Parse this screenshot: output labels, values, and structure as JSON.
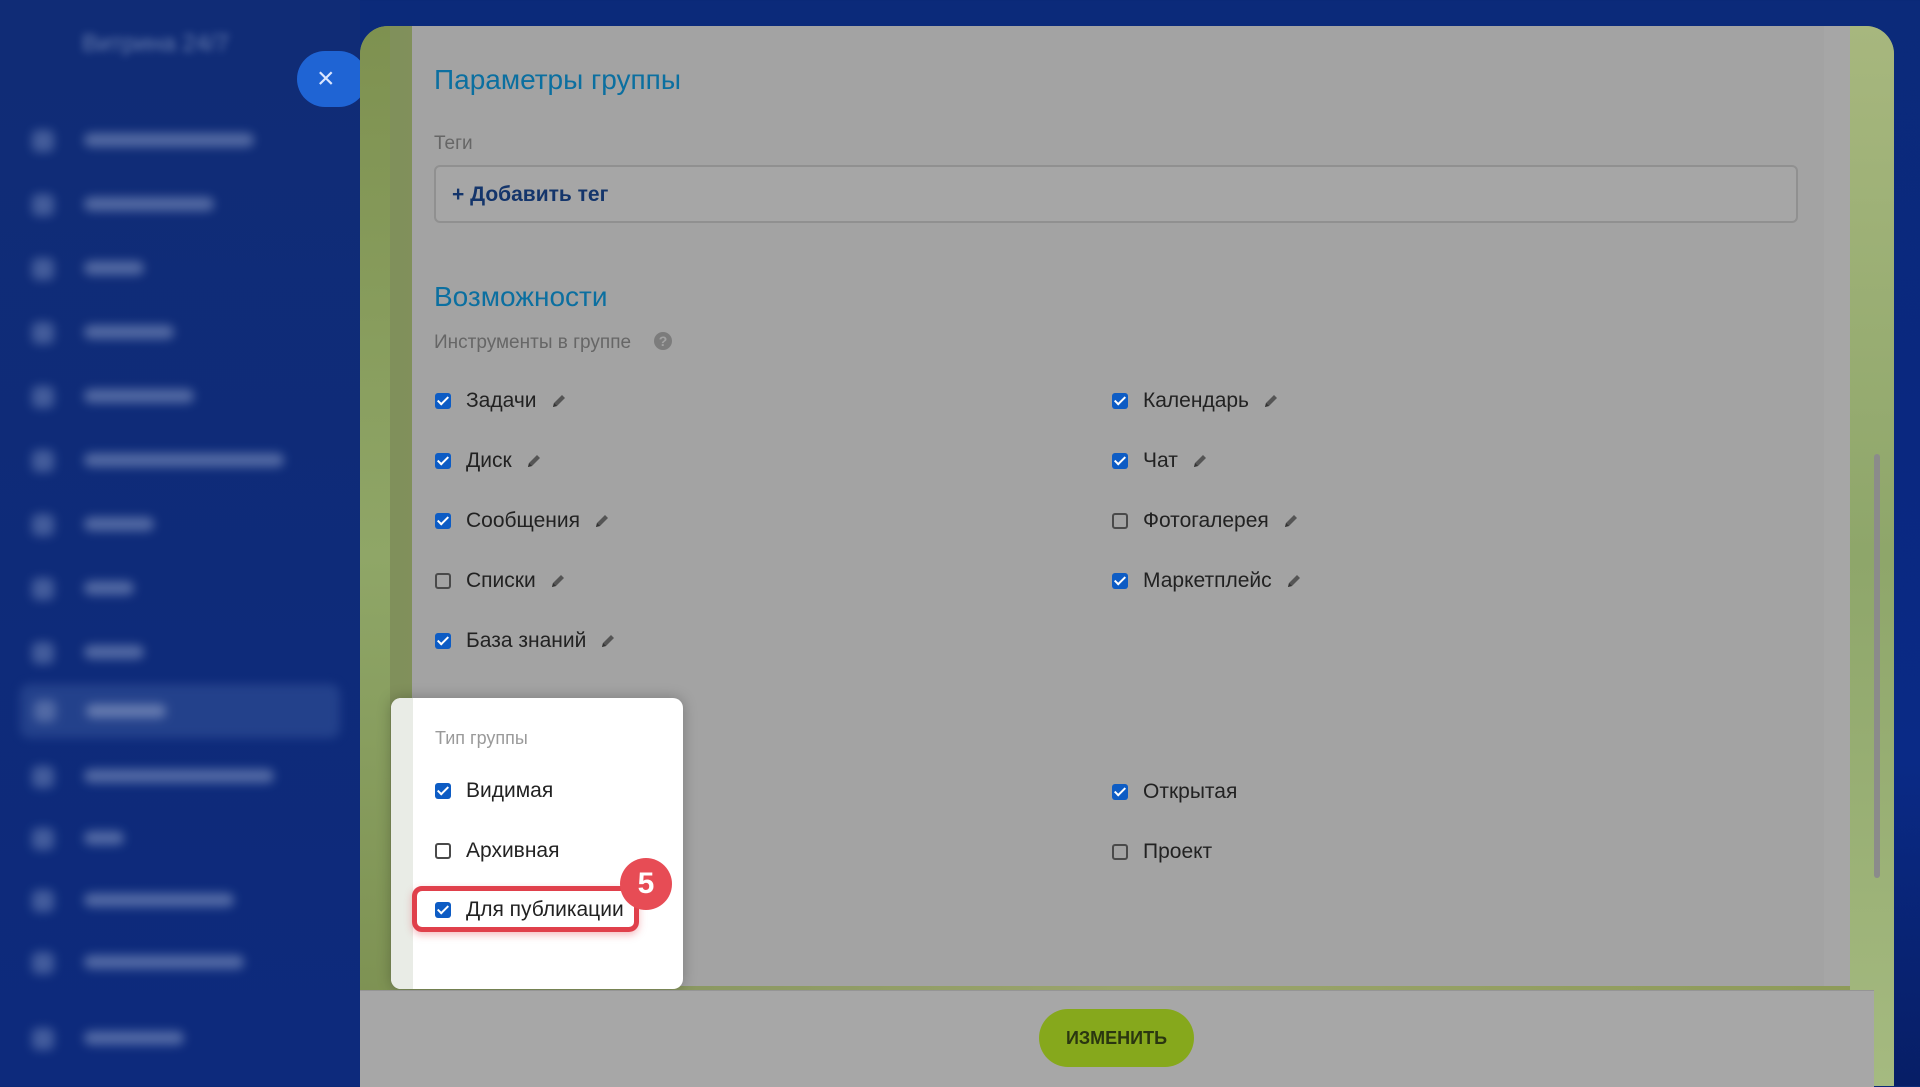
{
  "sidebar": {
    "title": "Витрина 24/7"
  },
  "close_button": {
    "icon": "×"
  },
  "group_params": {
    "title": "Параметры группы",
    "tags_label": "Теги",
    "add_tag": "+ Добавить тег"
  },
  "features": {
    "title": "Возможности",
    "tools_label": "Инструменты в группе",
    "help": "?",
    "tools": [
      {
        "label": "Задачи",
        "checked": true
      },
      {
        "label": "Календарь",
        "checked": true
      },
      {
        "label": "Диск",
        "checked": true
      },
      {
        "label": "Чат",
        "checked": true
      },
      {
        "label": "Сообщения",
        "checked": true
      },
      {
        "label": "Фотогалерея",
        "checked": false
      },
      {
        "label": "Списки",
        "checked": false
      },
      {
        "label": "Маркетплейс",
        "checked": true
      },
      {
        "label": "База знаний",
        "checked": true
      }
    ]
  },
  "group_type": {
    "title": "Тип группы",
    "options": [
      {
        "label": "Видимая",
        "checked": true
      },
      {
        "label": "Открытая",
        "checked": true
      },
      {
        "label": "Архивная",
        "checked": false
      },
      {
        "label": "Проект",
        "checked": false
      },
      {
        "label": "Для публикации",
        "checked": true
      }
    ]
  },
  "step_badge": "5",
  "footer": {
    "save_label": "ИЗМЕНИТЬ"
  },
  "colors": {
    "accent": "#0d5cc4",
    "heading": "#0b6fa0",
    "highlight": "#e0404b",
    "save_button": "#86a81c"
  }
}
